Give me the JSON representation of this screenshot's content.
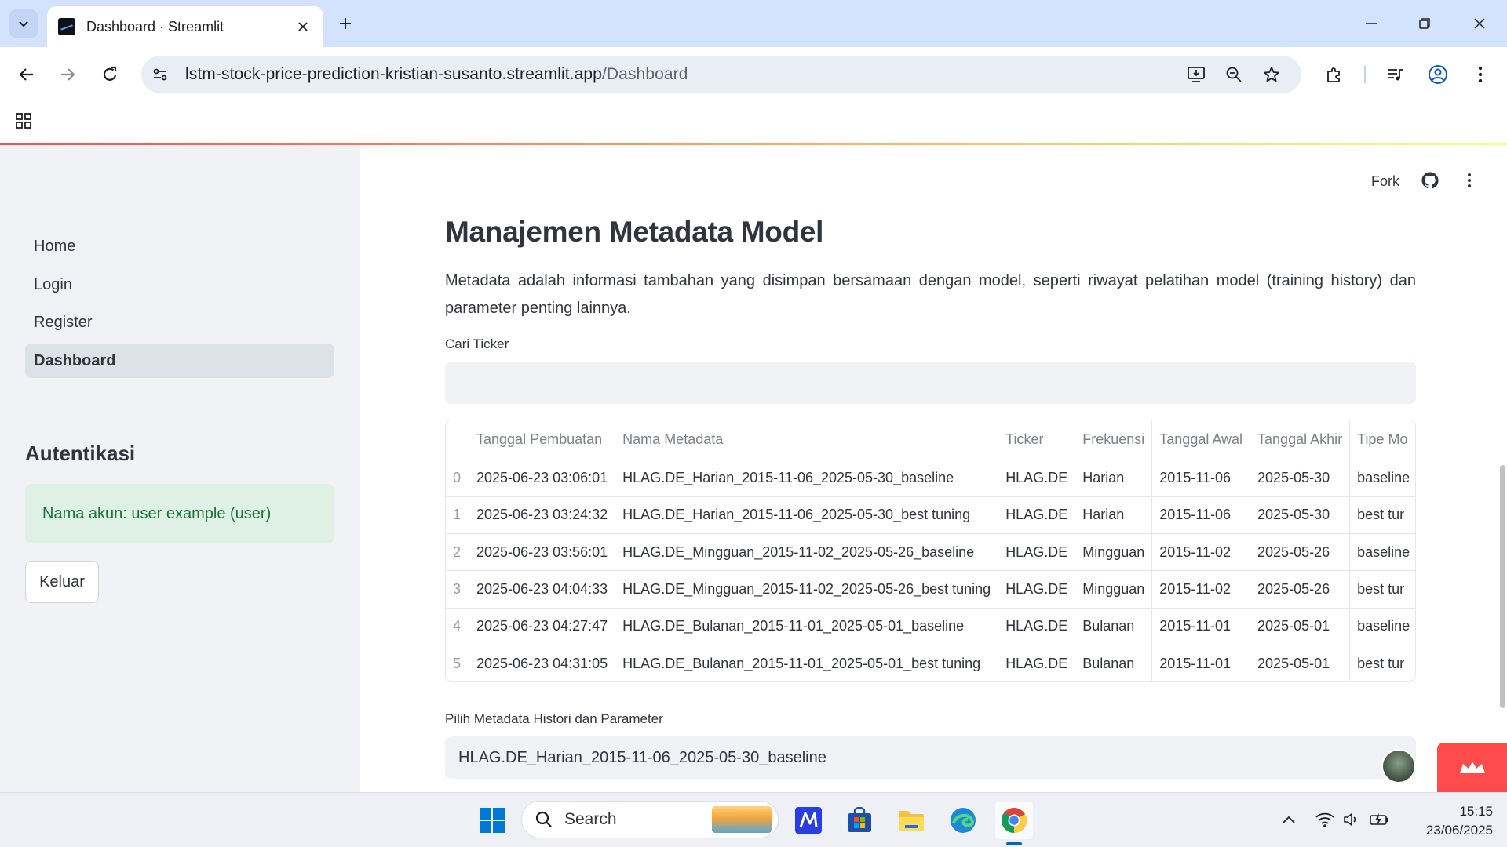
{
  "browser": {
    "tab_title": "Dashboard · Streamlit",
    "url_host": "lstm-stock-price-prediction-kristian-susanto.streamlit.app",
    "url_path": "/Dashboard"
  },
  "header": {
    "fork_label": "Fork"
  },
  "sidebar": {
    "nav_items": [
      {
        "label": "Home"
      },
      {
        "label": "Login"
      },
      {
        "label": "Register"
      },
      {
        "label": "Dashboard",
        "active": true
      }
    ],
    "auth_heading": "Autentikasi",
    "account_message": "Nama akun: user example (user)",
    "logout_label": "Keluar"
  },
  "main": {
    "title": "Manajemen Metadata Model",
    "intro": "Metadata adalah informasi tambahan yang disimpan bersamaan dengan model, seperti riwayat pelatihan model (training history) dan parameter penting lainnya.",
    "search_label": "Cari Ticker",
    "search_value": "",
    "table": {
      "columns": [
        "",
        "Tanggal Pembuatan",
        "Nama Metadata",
        "Ticker",
        "Frekuensi",
        "Tanggal Awal",
        "Tanggal Akhir",
        "Tipe Mo"
      ],
      "rows": [
        [
          "0",
          "2025-06-23 03:06:01",
          "HLAG.DE_Harian_2015-11-06_2025-05-30_baseline",
          "HLAG.DE",
          "Harian",
          "2015-11-06",
          "2025-05-30",
          "baseline"
        ],
        [
          "1",
          "2025-06-23 03:24:32",
          "HLAG.DE_Harian_2015-11-06_2025-05-30_best tuning",
          "HLAG.DE",
          "Harian",
          "2015-11-06",
          "2025-05-30",
          "best tur"
        ],
        [
          "2",
          "2025-06-23 03:56:01",
          "HLAG.DE_Mingguan_2015-11-02_2025-05-26_baseline",
          "HLAG.DE",
          "Mingguan",
          "2015-11-02",
          "2025-05-26",
          "baseline"
        ],
        [
          "3",
          "2025-06-23 04:04:33",
          "HLAG.DE_Mingguan_2015-11-02_2025-05-26_best tuning",
          "HLAG.DE",
          "Mingguan",
          "2015-11-02",
          "2025-05-26",
          "best tur"
        ],
        [
          "4",
          "2025-06-23 04:27:47",
          "HLAG.DE_Bulanan_2015-11-01_2025-05-01_baseline",
          "HLAG.DE",
          "Bulanan",
          "2015-11-01",
          "2025-05-01",
          "baseline"
        ],
        [
          "5",
          "2025-06-23 04:31:05",
          "HLAG.DE_Bulanan_2015-11-01_2025-05-01_best tuning",
          "HLAG.DE",
          "Bulanan",
          "2015-11-01",
          "2025-05-01",
          "best tur"
        ]
      ]
    },
    "select_label": "Pilih Metadata Histori dan Parameter",
    "select_value": "HLAG.DE_Harian_2015-11-06_2025-05-30_baseline"
  },
  "taskbar": {
    "search_placeholder": "Search",
    "time": "15:15",
    "date": "23/06/2025"
  },
  "colors": {
    "streamlit_red": "#ff4b4b",
    "sidebar_bg": "#f0f2f6",
    "success_bg": "#dff1e5",
    "success_text": "#177233"
  }
}
